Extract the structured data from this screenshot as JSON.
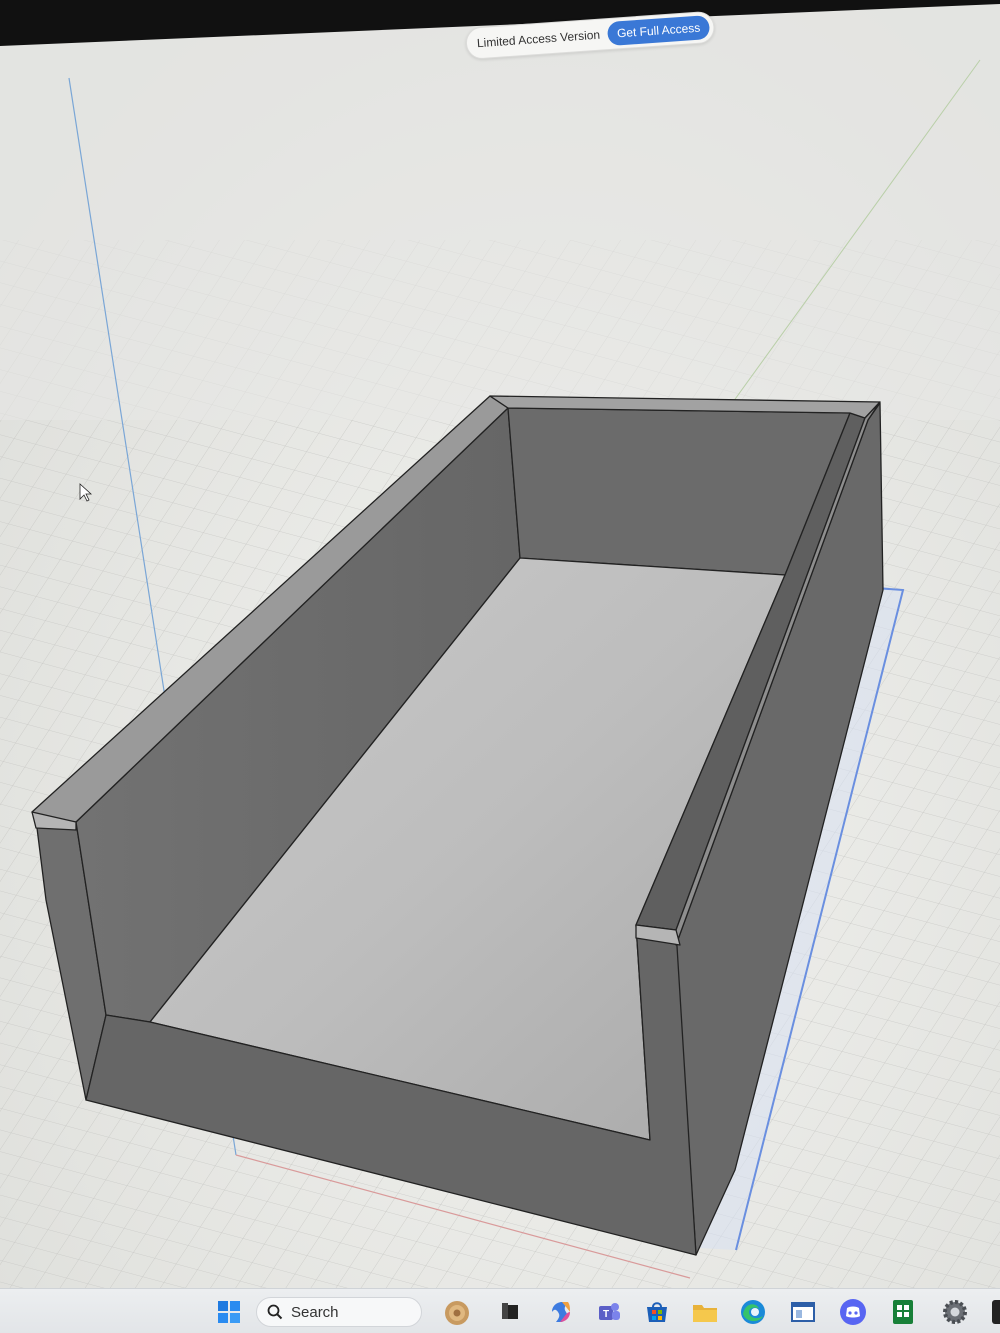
{
  "banner": {
    "label": "Limited Access Version",
    "button": "Get Full Access"
  },
  "taskbar": {
    "search_placeholder": "Search",
    "icons": [
      "windows-start-icon",
      "search-icon",
      "widgets-icon",
      "task-view-icon",
      "copilot-icon",
      "teams-icon",
      "microsoft-store-icon",
      "file-explorer-icon",
      "edge-icon",
      "app-window-icon",
      "discord-icon",
      "spreadsheet-icon",
      "settings-gear-icon",
      "app-icon"
    ]
  },
  "colors": {
    "canvas": "#e9e9e6",
    "grid": "#c9c9c6",
    "model_face": "#707070",
    "model_floor": "#b8b8b8",
    "selection": "#6a8fe0",
    "accent": "#3a78d6"
  }
}
